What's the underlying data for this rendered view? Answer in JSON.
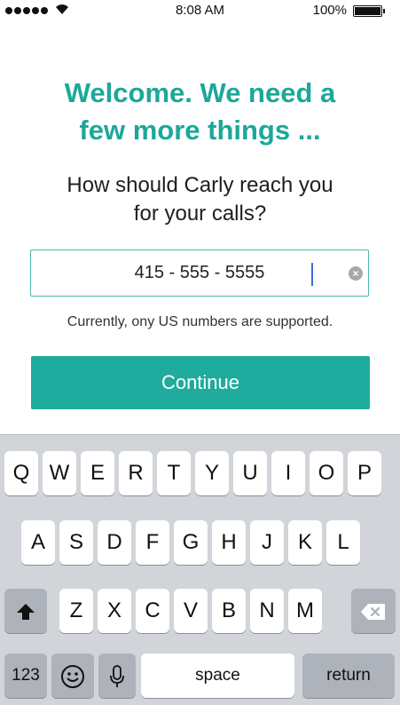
{
  "status_bar": {
    "time": "8:08 AM",
    "battery": "100%"
  },
  "heading": {
    "line1": "Welcome. We need a",
    "line2": "few more things ..."
  },
  "subheading": {
    "line1": "How should Carly reach you",
    "line2": "for your calls?"
  },
  "phone_input": {
    "value": "415 - 555 - 5555"
  },
  "note": "Currently, ony US numbers are supported.",
  "continue_label": "Continue",
  "keyboard": {
    "row1": [
      "Q",
      "W",
      "E",
      "R",
      "T",
      "Y",
      "U",
      "I",
      "O",
      "P"
    ],
    "row2": [
      "A",
      "S",
      "D",
      "F",
      "G",
      "H",
      "J",
      "K",
      "L"
    ],
    "row3": [
      "Z",
      "X",
      "C",
      "V",
      "B",
      "N",
      "M"
    ],
    "numbers_label": "123",
    "space_label": "space",
    "return_label": "return"
  },
  "icons": {
    "shift": "shift-icon",
    "delete": "backspace-icon",
    "emoji": "emoji-icon",
    "mic": "microphone-icon",
    "clear": "clear-icon",
    "wifi": "wifi-icon",
    "signal": "signal-icon",
    "battery": "battery-icon"
  },
  "colors": {
    "accent": "#1ba89a",
    "button": "#1fab9d",
    "keyboard_bg": "#d1d4d9",
    "caret": "#3a6cd8"
  }
}
